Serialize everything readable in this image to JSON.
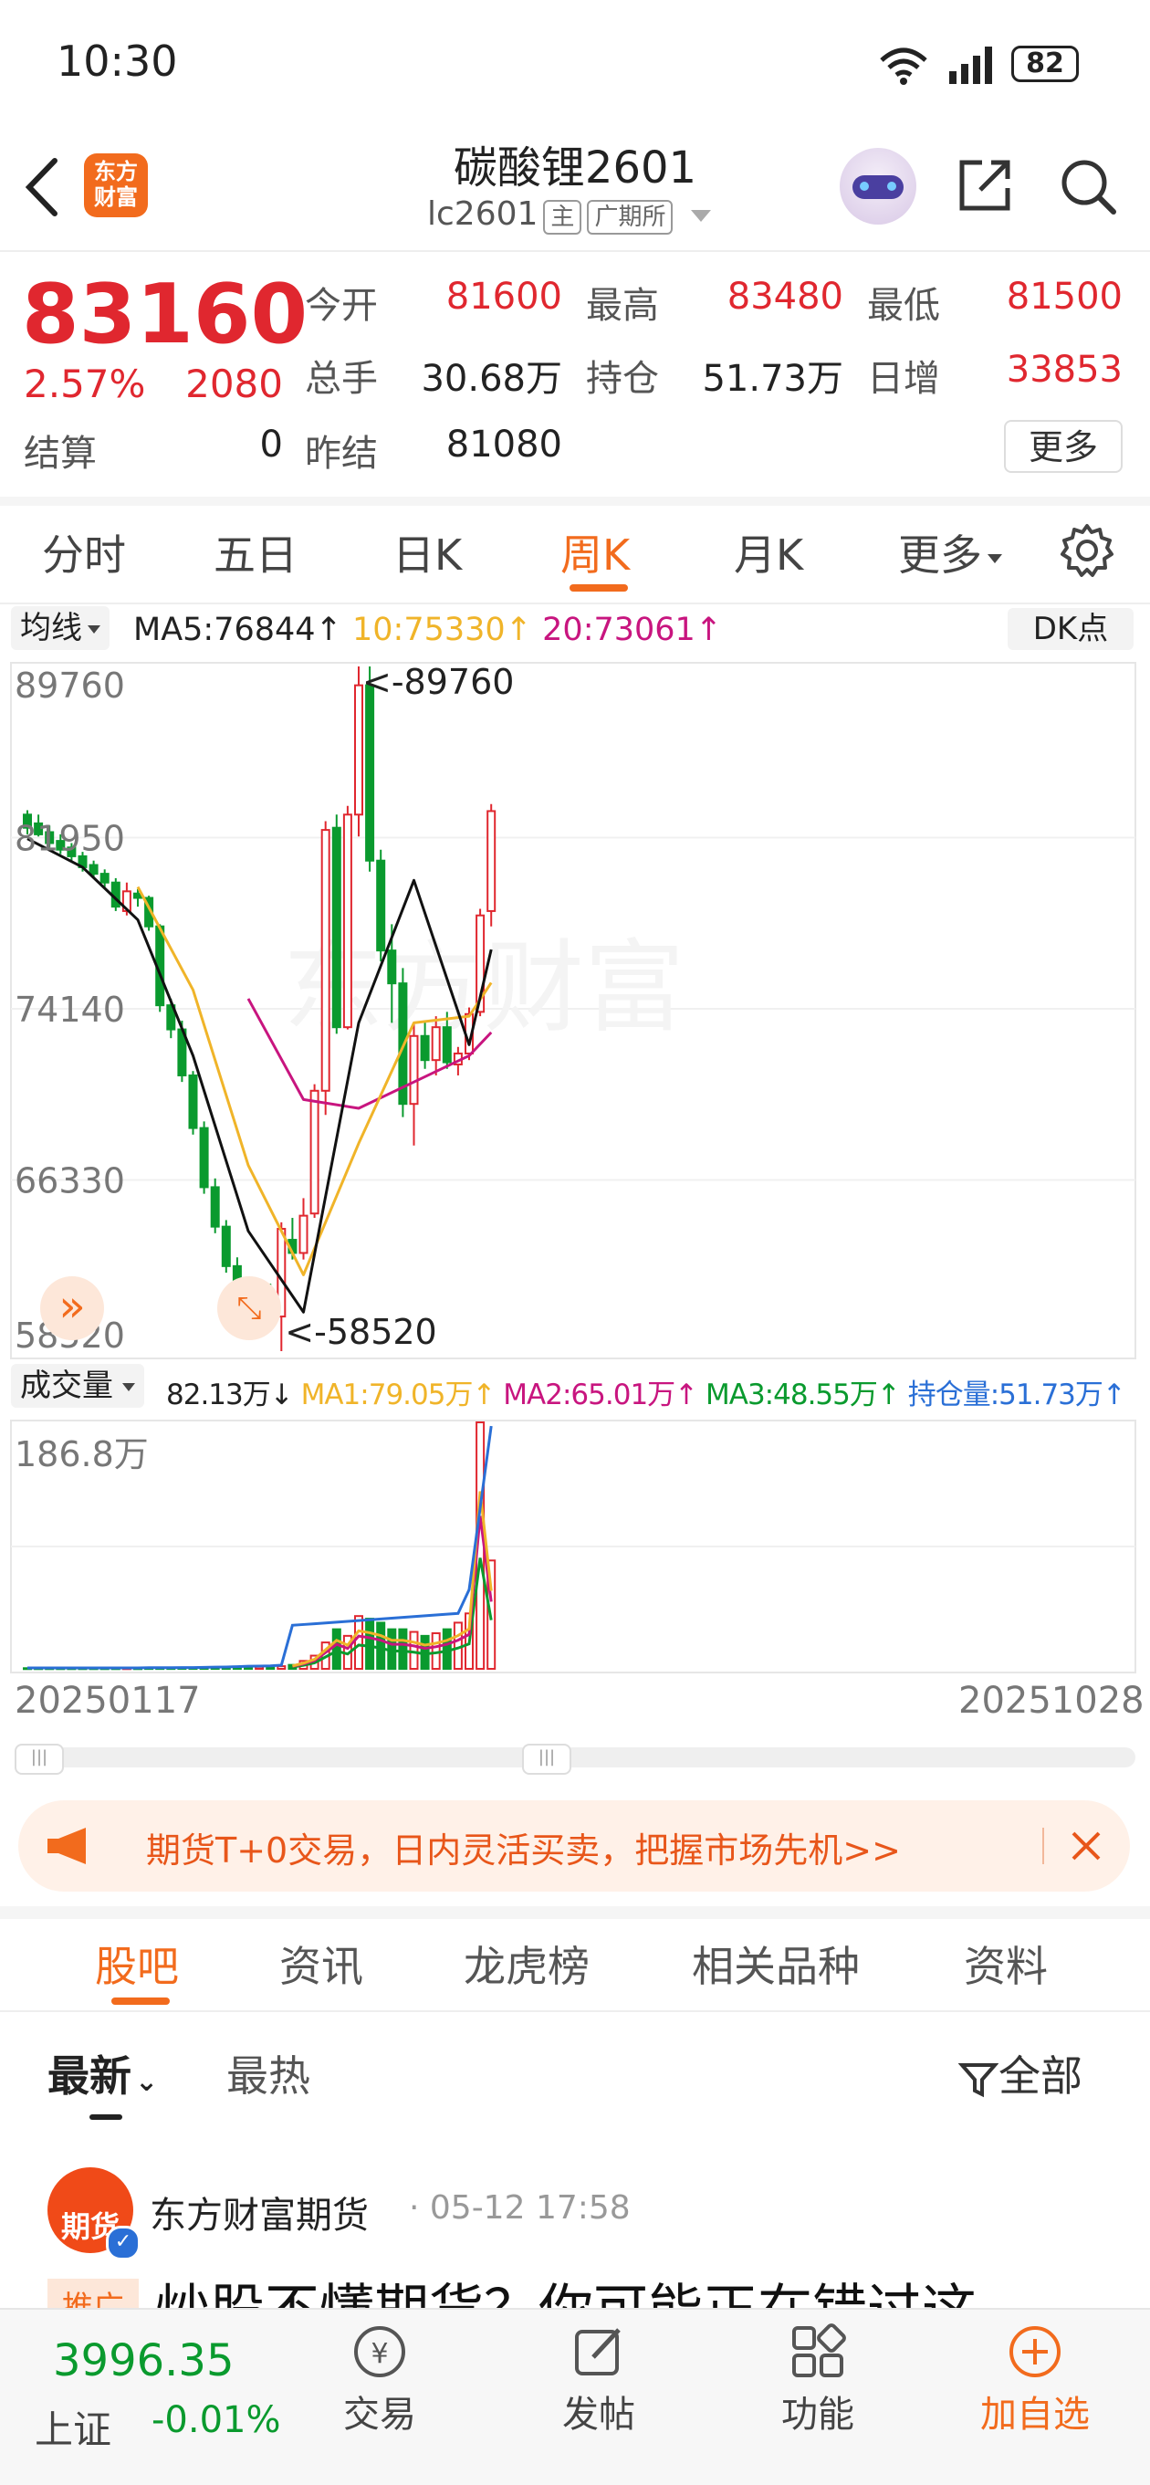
{
  "status_bar": {
    "time": "10:30",
    "battery": "82"
  },
  "header": {
    "logo_text": "东方\n财富",
    "logo_line1": "东方",
    "logo_line2": "财富",
    "title": "碳酸锂2601",
    "code": "lc2601",
    "tag_main": "主",
    "tag_exchange": "广期所"
  },
  "quote": {
    "price": "83160",
    "change_pct": "2.57%",
    "change": "2080",
    "settle_label": "结算",
    "settle_value": "0",
    "fields": [
      {
        "label": "今开",
        "value": "81600",
        "color": "red"
      },
      {
        "label": "最高",
        "value": "83480",
        "color": "red"
      },
      {
        "label": "最低",
        "value": "81500",
        "color": "red"
      },
      {
        "label": "总手",
        "value": "30.68万",
        "color": "dark"
      },
      {
        "label": "持仓",
        "value": "51.73万",
        "color": "dark"
      },
      {
        "label": "日增",
        "value": "33853",
        "color": "red"
      },
      {
        "label": "昨结",
        "value": "81080",
        "color": "dark"
      }
    ],
    "more_button": "更多"
  },
  "period_tabs": [
    "分时",
    "五日",
    "日K",
    "周K",
    "月K",
    "更多"
  ],
  "period_active": "周K",
  "ma_bar": {
    "selector": "均线",
    "ma5": "MA5:76844↑",
    "ma10": "10:75330↑",
    "ma20": "20:73061↑",
    "dk_button": "DK点"
  },
  "price_axis": [
    "89760",
    "81950",
    "74140",
    "66330",
    "58520"
  ],
  "annotations": {
    "high": "<-89760",
    "low": "<-58520"
  },
  "volume_bar": {
    "selector": "成交量",
    "vol": "82.13万↓",
    "ma1": "MA1:79.05万↑",
    "ma2": "MA2:65.01万↑",
    "ma3": "MA3:48.55万↑",
    "oi": "持仓量:51.73万↑",
    "axis_max": "186.8万"
  },
  "date_range": {
    "start": "20250117",
    "end": "20251028"
  },
  "promo": {
    "text": "期货T+0交易，日内灵活买卖，把握市场先机>>"
  },
  "sub_tabs": [
    "股吧",
    "资讯",
    "龙虎榜",
    "相关品种",
    "资料"
  ],
  "sub_active": "股吧",
  "feed": {
    "sort_latest": "最新",
    "sort_hot": "最热",
    "filter": "全部",
    "post_author": "东方财富期货",
    "post_time": "· 05-12 17:58",
    "post_avatar": "期货",
    "post_tag": "推广",
    "post_title": "炒股不懂期货？你可能正在错过这"
  },
  "bottom_nav": {
    "index_value": "3996.35",
    "index_name": "上证",
    "index_change": "-0.01%",
    "items": [
      "交易",
      "发帖",
      "功能",
      "加自选"
    ]
  },
  "colors": {
    "up": "#e0272f",
    "down": "#0a9a2e",
    "accent": "#f26b1d",
    "ma5": "#111111",
    "ma10": "#f0b429",
    "ma20": "#c8157f"
  },
  "chart_data": {
    "type": "candlestick",
    "series_candles": [
      [
        83000,
        83200,
        82100,
        82400
      ],
      [
        82600,
        83000,
        82000,
        82100
      ],
      [
        82200,
        82500,
        81500,
        81700
      ],
      [
        81800,
        82100,
        81200,
        81400
      ],
      [
        81500,
        81700,
        80900,
        81100
      ],
      [
        81100,
        81300,
        80400,
        80600
      ],
      [
        80700,
        80900,
        80100,
        80300
      ],
      [
        80300,
        80500,
        79700,
        79900
      ],
      [
        79900,
        80100,
        78600,
        78800
      ],
      [
        78600,
        79900,
        78400,
        79500
      ],
      [
        79400,
        79600,
        78800,
        79200
      ],
      [
        79200,
        79300,
        77700,
        77900
      ],
      [
        77900,
        78000,
        74000,
        74300
      ],
      [
        74300,
        74600,
        72800,
        73200
      ],
      [
        73200,
        73600,
        70800,
        71100
      ],
      [
        71100,
        71300,
        68400,
        68700
      ],
      [
        68700,
        69000,
        65700,
        66000
      ],
      [
        66000,
        66400,
        63900,
        64200
      ],
      [
        64200,
        64500,
        62100,
        62400
      ],
      [
        62400,
        62800,
        60600,
        60900
      ],
      [
        60900,
        61300,
        59600,
        59900
      ],
      [
        59900,
        61700,
        59200,
        61200
      ],
      [
        61200,
        61600,
        59800,
        60000
      ],
      [
        60100,
        64400,
        58520,
        64100
      ],
      [
        63600,
        64600,
        62700,
        63000
      ],
      [
        63000,
        65500,
        62700,
        64700
      ],
      [
        64800,
        70700,
        64600,
        70400
      ],
      [
        70400,
        82700,
        69300,
        82300
      ],
      [
        82400,
        83000,
        73000,
        73300
      ],
      [
        73300,
        83400,
        73200,
        83000
      ],
      [
        83000,
        89760,
        82000,
        88900
      ],
      [
        88900,
        89760,
        80400,
        80900
      ],
      [
        80900,
        81400,
        76300,
        76800
      ],
      [
        76800,
        78000,
        73500,
        75300
      ],
      [
        75300,
        76000,
        69200,
        69800
      ],
      [
        69800,
        73500,
        67900,
        72900
      ],
      [
        72900,
        73600,
        71400,
        71800
      ],
      [
        71800,
        73800,
        71100,
        73300
      ],
      [
        73300,
        74000,
        71400,
        71700
      ],
      [
        71600,
        72400,
        71100,
        72100
      ],
      [
        72100,
        74200,
        71800,
        73900
      ],
      [
        74000,
        78700,
        73800,
        78400
      ],
      [
        78600,
        83480,
        77900,
        83160
      ]
    ],
    "ma5_x": [
      0,
      5,
      10,
      15,
      20,
      25,
      30,
      35,
      40,
      42
    ],
    "ma5_y": [
      81900,
      80600,
      78200,
      72000,
      64000,
      60300,
      73500,
      80000,
      72500,
      76844
    ],
    "ma10_x": [
      10,
      15,
      20,
      25,
      30,
      35,
      40,
      42
    ],
    "ma10_y": [
      79700,
      75000,
      67000,
      62000,
      68000,
      73500,
      73800,
      75330
    ],
    "ma20_x": [
      20,
      25,
      30,
      35,
      40,
      42
    ],
    "ma20_y": [
      74600,
      70000,
      69600,
      70800,
      72000,
      73061
    ],
    "volume": [
      [
        0,
        0.5
      ],
      [
        1,
        0.5
      ],
      [
        2,
        0.5
      ],
      [
        3,
        0.5
      ],
      [
        4,
        0.5
      ],
      [
        5,
        0.5
      ],
      [
        6,
        0.5
      ],
      [
        7,
        0.5
      ],
      [
        8,
        0.5
      ],
      [
        9,
        0.5
      ],
      [
        10,
        0.5
      ],
      [
        11,
        0.6
      ],
      [
        12,
        0.6
      ],
      [
        13,
        0.6
      ],
      [
        14,
        0.7
      ],
      [
        15,
        0.7
      ],
      [
        16,
        0.8
      ],
      [
        17,
        0.9
      ],
      [
        18,
        1.0
      ],
      [
        19,
        1.2
      ],
      [
        20,
        1.4
      ],
      [
        21,
        1.5
      ],
      [
        22,
        1.6
      ],
      [
        23,
        2.0
      ],
      [
        24,
        3.0
      ],
      [
        25,
        6.0
      ],
      [
        26,
        10
      ],
      [
        27,
        20
      ],
      [
        28,
        30
      ],
      [
        29,
        25
      ],
      [
        30,
        40
      ],
      [
        31,
        38
      ],
      [
        32,
        35
      ],
      [
        33,
        30
      ],
      [
        34,
        30
      ],
      [
        35,
        28
      ],
      [
        36,
        25
      ],
      [
        37,
        27
      ],
      [
        38,
        30
      ],
      [
        39,
        35
      ],
      [
        40,
        42
      ],
      [
        41,
        186.8
      ],
      [
        42,
        82.13
      ]
    ],
    "y_range": [
      58520,
      89760
    ],
    "vol_max": 186.8
  }
}
